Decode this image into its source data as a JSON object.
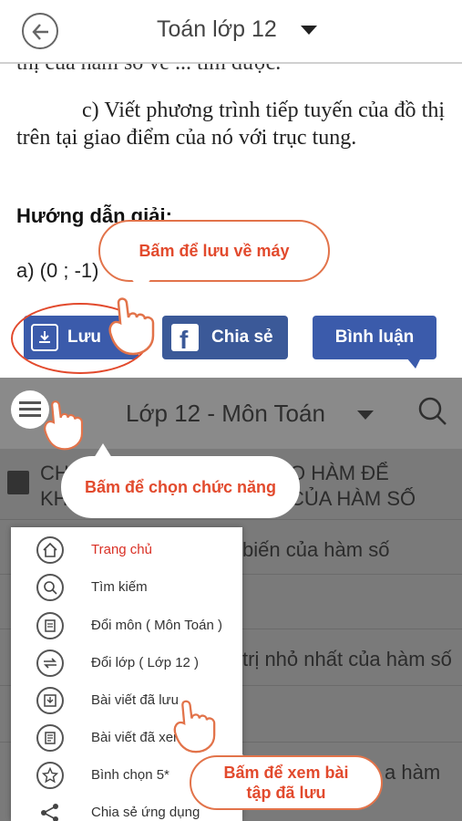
{
  "topbar": {
    "title": "Toán lớp 12",
    "back_icon": "back-arrow-icon"
  },
  "article": {
    "clipped_line": "thị của hàm số vẽ ... tìm được.",
    "paragraph": "c) Viết phương trình tiếp tuyến của đồ thị trên tại giao điểm của nó với trục tung.",
    "hint_title": "Hướng dẫn giải:",
    "answer": "a) (0 ; -1)"
  },
  "actions": {
    "save_label": "Lưu",
    "share_label": "Chia sẻ",
    "comment_label": "Bình luận"
  },
  "subbar": {
    "title": "Lớp 12 - Môn Toán"
  },
  "list_rows": [
    {
      "left": "CH",
      "right": "O HÀM ĐỂ"
    },
    {
      "left": "KH",
      "right": "CỦA HÀM SỐ"
    },
    {
      "text": "biến của hàm số"
    },
    {
      "text": "trị nhỏ nhất của hàm số"
    },
    {
      "text": "a hàm"
    }
  ],
  "drawer": {
    "items": [
      {
        "label": "Trang chủ",
        "icon": "home-icon"
      },
      {
        "label": "Tìm kiếm",
        "icon": "search-icon"
      },
      {
        "label": "Đổi môn ( Môn Toán )",
        "icon": "switch-subject-icon"
      },
      {
        "label": "Đổi lớp ( Lớp 12 )",
        "icon": "switch-class-icon"
      },
      {
        "label": "Bài viết đã lưu",
        "icon": "saved-icon"
      },
      {
        "label": "Bài viết đã xem",
        "icon": "history-icon"
      },
      {
        "label": "Bình chọn 5*",
        "icon": "star-icon"
      },
      {
        "label": "Chia sẻ ứng dụng",
        "icon": "share-icon"
      }
    ]
  },
  "callouts": {
    "save": "Bấm để lưu về máy",
    "menu": "Bấm để chọn chức năng",
    "saved_posts_line1": "Bấm để xem bài",
    "saved_posts_line2": "tập đã lưu"
  },
  "colors": {
    "accent": "#e24a2d",
    "button_blue": "#3b5bab",
    "facebook_blue": "#3b5998",
    "active_menu": "#d93025"
  }
}
